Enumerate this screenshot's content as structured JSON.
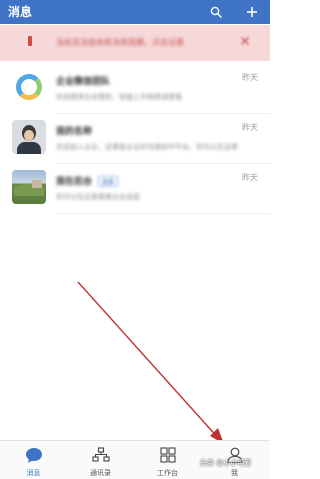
{
  "header": {
    "title": "消息",
    "search_icon": "search-icon",
    "add_icon": "plus-icon",
    "background": "#3f73c6"
  },
  "banner": {
    "text": "当前无法接收新消息提醒，点击设置",
    "close_icon": "close-icon",
    "background": "#f6d8d8",
    "accent": "#d24a4a"
  },
  "messages": [
    {
      "name": "企业微信团队",
      "preview": "欢迎使用企业微信，快速上手指南请查看",
      "time": "昨天",
      "avatar": "team-logo"
    },
    {
      "name": "我的名称",
      "preview": "欢迎加入企业，这里是企业的沟通协作平台，你可以在这里",
      "time": "昨天",
      "avatar": "person-photo"
    },
    {
      "name": "我在后台",
      "tag": "企业",
      "preview": "你可以在这里查看企业动态",
      "time": "昨天",
      "avatar": "landscape-photo"
    }
  ],
  "tabs": [
    {
      "label": "消息",
      "icon": "chat-bubble-icon",
      "active": true
    },
    {
      "label": "通讯录",
      "icon": "contacts-tree-icon",
      "active": false
    },
    {
      "label": "工作台",
      "icon": "workbench-grid-icon",
      "active": false
    },
    {
      "label": "我",
      "icon": "person-icon",
      "active": false
    }
  ],
  "annotation": {
    "color": "#c03030"
  },
  "watermark": "头条 @小小可爱"
}
